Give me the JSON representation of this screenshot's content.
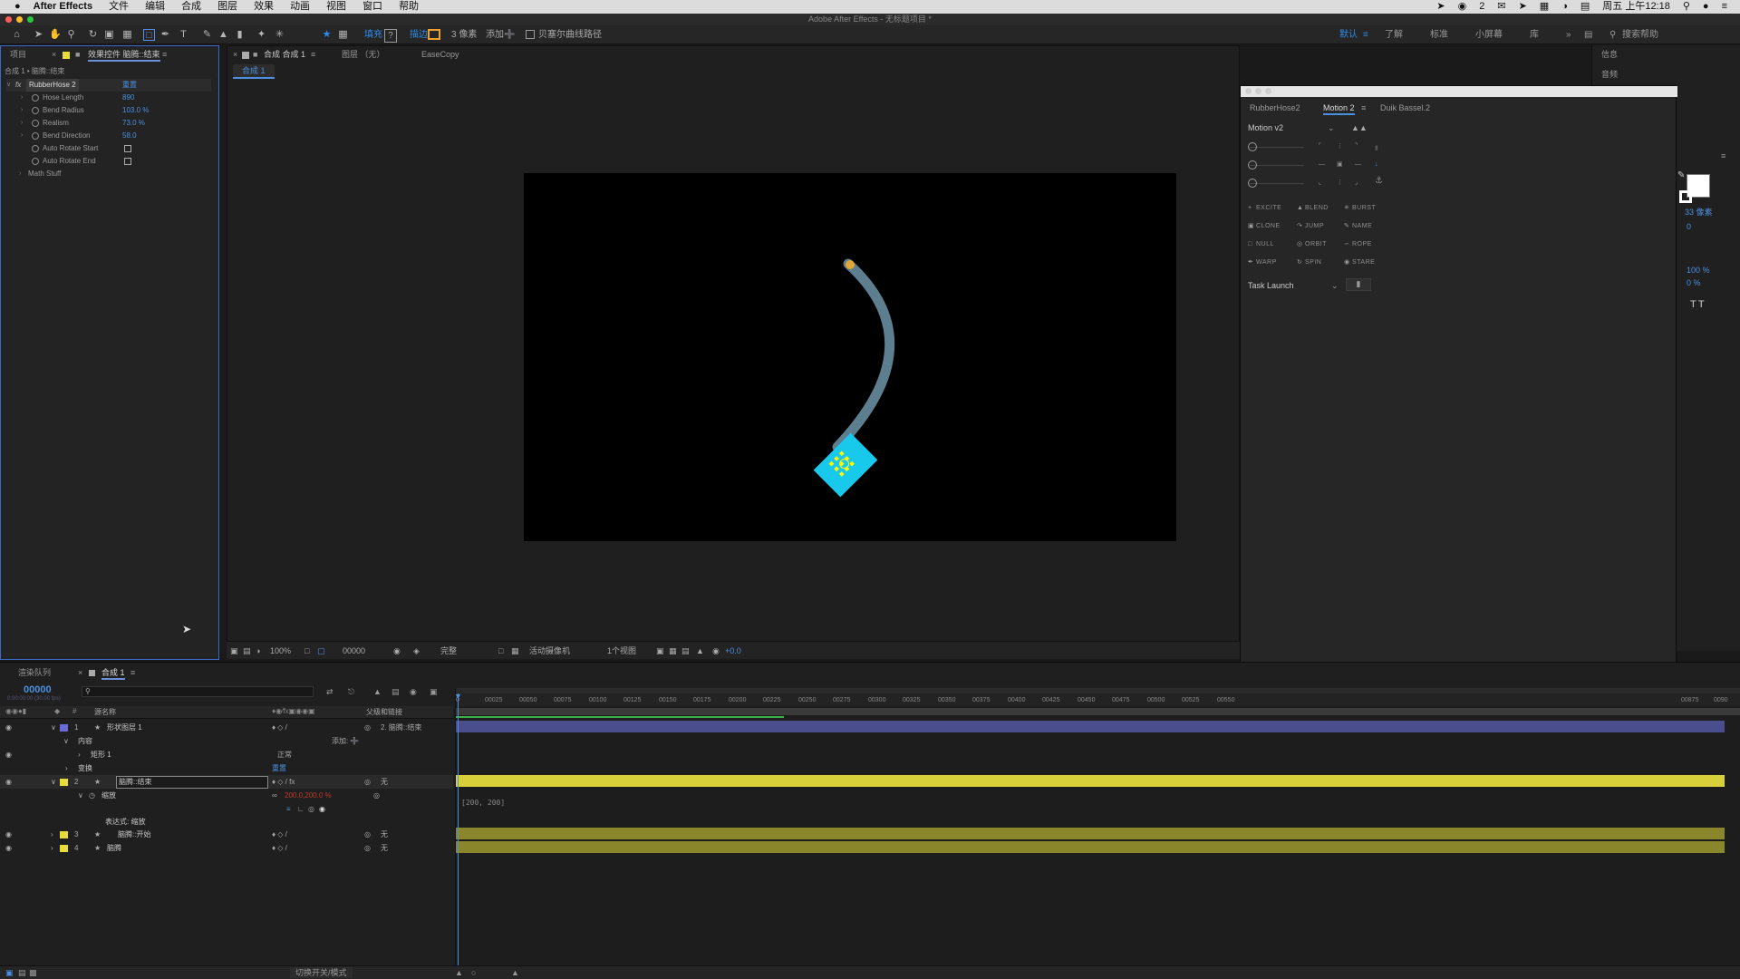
{
  "menubar": {
    "apple": "",
    "app": "After Effects",
    "items": [
      "文件",
      "编辑",
      "合成",
      "图层",
      "效果",
      "动画",
      "视图",
      "窗口",
      "帮助"
    ],
    "badge": "2",
    "clock": "周五 上午12:18"
  },
  "window": {
    "title": "Adobe After Effects - 无标题项目 *"
  },
  "toolbar": {
    "fill_label": "填充",
    "fill_value": "?",
    "stroke_label": "描边",
    "stroke_px": "3 像素",
    "add_label": "添加",
    "bezier_label": "贝塞尔曲线路径",
    "workspaces": [
      "默认",
      "了解",
      "标准",
      "小屏幕",
      "库"
    ],
    "search_placeholder": "搜索帮助",
    "accent_color": "#2d8ceb"
  },
  "left_panel": {
    "tab_project": "项目",
    "tab_effects": "效果控件 脑腾::结束",
    "breadcrumb": "合成 1 • 脑腾::结束",
    "effect_name": "RubberHose 2",
    "reset_label": "重置",
    "props": [
      {
        "label": "Hose Length",
        "value": "890"
      },
      {
        "label": "Bend Radius",
        "value": "103.0 %"
      },
      {
        "label": "Realism",
        "value": "73.0 %"
      },
      {
        "label": "Bend Direction",
        "value": "58.0"
      },
      {
        "label": "Auto Rotate Start",
        "value": ""
      },
      {
        "label": "Auto Rotate End",
        "value": ""
      },
      {
        "label": "Math Stuff",
        "value": ""
      }
    ]
  },
  "viewer": {
    "tab_comp": "合成 合成 1",
    "tab_layer": "图层 （无）",
    "tab_easecopy": "EaseCopy",
    "comp_chip": "合成 1",
    "zoom": "100%",
    "timecode": "00000",
    "quality": "完整",
    "camera": "活动摄像机",
    "views": "1个视图",
    "exposure": "+0.0"
  },
  "motion_panel": {
    "tabs": [
      "RubberHose2",
      "Motion 2",
      "Duik Bassel.2"
    ],
    "preset": "Motion v2",
    "buttons": [
      "EXCITE",
      "BLEND",
      "BURST",
      "CLONE",
      "JUMP",
      "NAME",
      "NULL",
      "ORBIT",
      "ROPE",
      "WARP",
      "SPIN",
      "STARE"
    ],
    "task": "Task Launch"
  },
  "right_dock": {
    "info": "信息",
    "audio": "音频",
    "stroke_px": "33 像素",
    "val1": "0",
    "pct1": "100 %",
    "pct2": "0 %"
  },
  "timeline": {
    "tab_render": "渲染队列",
    "tab_comp": "合成 1",
    "timecode": "00000",
    "timecode_sub": "0:00:00:00 (30.00 fps)",
    "search_placeholder": "",
    "col_name": "源名称",
    "col_parent": "父级和链接",
    "ruler": [
      "00025",
      "00050",
      "00075",
      "00100",
      "00125",
      "00150",
      "00175",
      "00200",
      "00225",
      "00250",
      "00275",
      "00300",
      "00325",
      "00350",
      "00375",
      "00400",
      "00425",
      "00450",
      "00475",
      "00500",
      "00525",
      "00550"
    ],
    "ruler_end": [
      "00875",
      "0090"
    ],
    "layers": [
      {
        "num": "1",
        "name": "形状图层 1",
        "color": "#6a6ad8",
        "parent": "2. 脑腾::结束"
      },
      {
        "num": "",
        "name": "内容",
        "color": "",
        "parent": ""
      },
      {
        "num": "",
        "name": "矩形 1",
        "color": "",
        "parent": "正常"
      },
      {
        "num": "",
        "name": "变换",
        "color": "",
        "parent": "重置"
      },
      {
        "num": "2",
        "name": "脑腾::结束",
        "color": "#e8dc3a",
        "parent": "无"
      },
      {
        "num": "",
        "name": "缩放",
        "color": "",
        "parent": ""
      },
      {
        "num": "",
        "name": "表达式: 缩放",
        "color": "",
        "parent": ""
      },
      {
        "num": "3",
        "name": "脑腾::开始",
        "color": "#e8dc3a",
        "parent": "无"
      },
      {
        "num": "4",
        "name": "脑腾",
        "color": "#e8dc3a",
        "parent": "无"
      }
    ],
    "add_label": "添加:",
    "scale_value": "200.0,200.0 %",
    "expression_text": "[200, 200]",
    "status_toggle": "切换开关/模式"
  }
}
